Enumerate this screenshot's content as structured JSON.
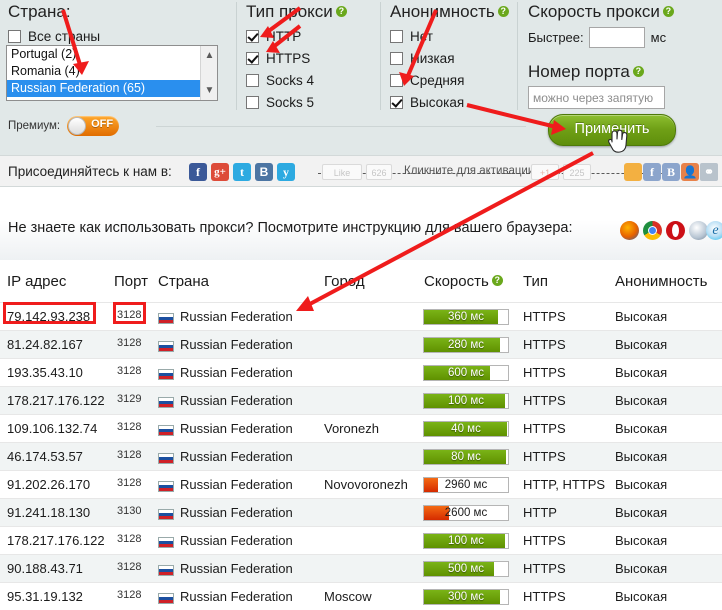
{
  "filters": {
    "country": {
      "title": "Страна:",
      "all_label": "Все страны",
      "all_checked": false,
      "options": [
        {
          "label": "Portugal (2)",
          "selected": false
        },
        {
          "label": "Romania (4)",
          "selected": false
        },
        {
          "label": "Russian Federation (65)",
          "selected": true
        }
      ],
      "scroll_up_icon": "chevron-up-icon",
      "scroll_down_icon": "chevron-down-icon"
    },
    "premium": {
      "label": "Премиум:",
      "state": "OFF"
    },
    "proxy_type": {
      "title": "Тип прокси",
      "help_glyph": "?",
      "items": [
        {
          "label": "HTTP",
          "checked": true
        },
        {
          "label": "HTTPS",
          "checked": true
        },
        {
          "label": "Socks 4",
          "checked": false
        },
        {
          "label": "Socks 5",
          "checked": false
        }
      ]
    },
    "anonymity": {
      "title": "Анонимность",
      "help_glyph": "?",
      "items": [
        {
          "label": "Нет",
          "checked": false
        },
        {
          "label": "Низкая",
          "checked": false
        },
        {
          "label": "Средняя",
          "checked": false
        },
        {
          "label": "Высокая",
          "checked": true
        }
      ]
    },
    "speed": {
      "title": "Скорость прокси",
      "help_glyph": "?",
      "faster_label": "Быстрее:",
      "value": "",
      "unit": "мс"
    },
    "port": {
      "title": "Номер порта",
      "help_glyph": "?",
      "value": "",
      "placeholder": "можно через запятую"
    },
    "apply_label": "Применить"
  },
  "social": {
    "join_label": "Присоединяйтесь к нам в:",
    "networks": [
      {
        "name": "facebook-icon",
        "glyph": "f",
        "color": "#3b5998"
      },
      {
        "name": "google-plus-icon",
        "glyph": "g+",
        "color": "#dd4b39"
      },
      {
        "name": "twitter-icon",
        "glyph": "t",
        "color": "#2daae1"
      },
      {
        "name": "vk-icon",
        "glyph": "B",
        "color": "#4c75a3"
      },
      {
        "name": "surfingbird-icon",
        "glyph": "y",
        "color": "#2daae1"
      }
    ],
    "like_label": "Like",
    "like_count": "626",
    "activation_label": "Кликните для активации",
    "gplus_label": "+1",
    "gplus_count": "225",
    "share_icons": [
      {
        "name": "mailru-icon",
        "color": "#f3b041"
      },
      {
        "name": "facebook-share-icon",
        "color": "#8ca5cc"
      },
      {
        "name": "vk-share-icon",
        "color": "#8ca5cc"
      },
      {
        "name": "odnoklassniki-icon",
        "color": "#e8824a"
      },
      {
        "name": "link-icon",
        "color": "#b9c3cc"
      }
    ]
  },
  "instructions": {
    "text": "Не знаете как использовать прокси? Посмотрите инструкцию для вашего браузера:",
    "browsers": [
      {
        "name": "firefox-icon",
        "color": "#e66000"
      },
      {
        "name": "chrome-icon",
        "color": "#4caf50"
      },
      {
        "name": "opera-icon",
        "color": "#cc0f16"
      },
      {
        "name": "safari-icon",
        "color": "#8ea3b7"
      },
      {
        "name": "internet-explorer-icon",
        "color": "#1ebbee"
      }
    ]
  },
  "table": {
    "columns": [
      {
        "key": "ip",
        "label": "IP адрес"
      },
      {
        "key": "port",
        "label": "Порт"
      },
      {
        "key": "country",
        "label": "Страна"
      },
      {
        "key": "city",
        "label": "Город"
      },
      {
        "key": "speed",
        "label": "Скорость",
        "help_glyph": "?"
      },
      {
        "key": "type",
        "label": "Тип"
      },
      {
        "key": "anonymity",
        "label": "Анонимность"
      }
    ],
    "rows": [
      {
        "ip": "79.142.93.238",
        "port": "3128",
        "country": "Russian Federation",
        "city": "",
        "speed_label": "360 мс",
        "speed_ms": 360,
        "speed_pct": 88,
        "speed_color": "green",
        "type": "HTTPS",
        "anonymity": "Высокая"
      },
      {
        "ip": "81.24.82.167",
        "port": "3128",
        "country": "Russian Federation",
        "city": "",
        "speed_label": "280 мс",
        "speed_ms": 280,
        "speed_pct": 91,
        "speed_color": "green",
        "type": "HTTPS",
        "anonymity": "Высокая"
      },
      {
        "ip": "193.35.43.10",
        "port": "3128",
        "country": "Russian Federation",
        "city": "",
        "speed_label": "600 мс",
        "speed_ms": 600,
        "speed_pct": 78,
        "speed_color": "green",
        "type": "HTTPS",
        "anonymity": "Высокая"
      },
      {
        "ip": "178.217.176.122",
        "port": "3129",
        "country": "Russian Federation",
        "city": "",
        "speed_label": "100 мс",
        "speed_ms": 100,
        "speed_pct": 97,
        "speed_color": "green",
        "type": "HTTPS",
        "anonymity": "Высокая"
      },
      {
        "ip": "109.106.132.74",
        "port": "3128",
        "country": "Russian Federation",
        "city": "Voronezh",
        "speed_label": "40 мс",
        "speed_ms": 40,
        "speed_pct": 99,
        "speed_color": "green",
        "type": "HTTPS",
        "anonymity": "Высокая"
      },
      {
        "ip": "46.174.53.57",
        "port": "3128",
        "country": "Russian Federation",
        "city": "",
        "speed_label": "80 мс",
        "speed_ms": 80,
        "speed_pct": 98,
        "speed_color": "green",
        "type": "HTTPS",
        "anonymity": "Высокая"
      },
      {
        "ip": "91.202.26.170",
        "port": "3128",
        "country": "Russian Federation",
        "city": "Novovoronezh",
        "speed_label": "2960 мс",
        "speed_ms": 2960,
        "speed_pct": 17,
        "speed_color": "red",
        "type": "HTTP, HTTPS",
        "anonymity": "Высокая"
      },
      {
        "ip": "91.241.18.130",
        "port": "3130",
        "country": "Russian Federation",
        "city": "",
        "speed_label": "2600 мс",
        "speed_ms": 2600,
        "speed_pct": 30,
        "speed_color": "red",
        "type": "HTTP",
        "anonymity": "Высокая"
      },
      {
        "ip": "178.217.176.122",
        "port": "3128",
        "country": "Russian Federation",
        "city": "",
        "speed_label": "100 мс",
        "speed_ms": 100,
        "speed_pct": 97,
        "speed_color": "green",
        "type": "HTTPS",
        "anonymity": "Высокая"
      },
      {
        "ip": "90.188.43.71",
        "port": "3128",
        "country": "Russian Federation",
        "city": "",
        "speed_label": "500 мс",
        "speed_ms": 500,
        "speed_pct": 83,
        "speed_color": "green",
        "type": "HTTPS",
        "anonymity": "Высокая"
      },
      {
        "ip": "95.31.19.132",
        "port": "3128",
        "country": "Russian Federation",
        "city": "Moscow",
        "speed_label": "300 мс",
        "speed_ms": 300,
        "speed_pct": 90,
        "speed_color": "green",
        "type": "HTTPS",
        "anonymity": "Высокая"
      }
    ]
  },
  "annotations": {
    "color": "#ef1c1c",
    "highlight_boxes": [
      "ip-cell-row-1",
      "port-cell-row-1"
    ]
  }
}
